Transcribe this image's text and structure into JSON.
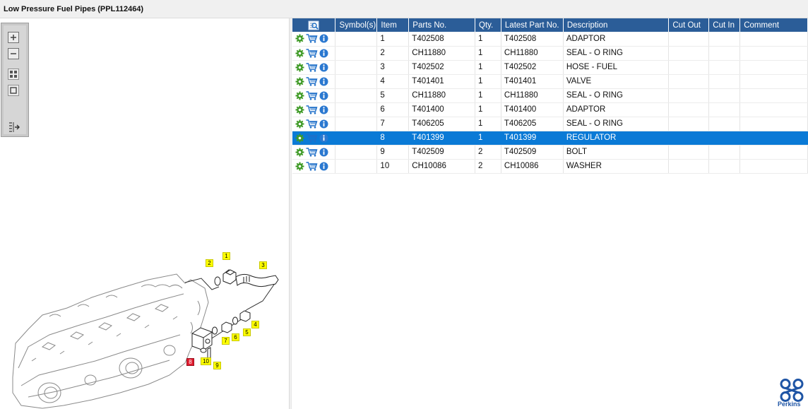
{
  "window": {
    "title": "Low Pressure Fuel Pipes (PPL112464)"
  },
  "toolbar": {
    "buttons": [
      "zoom-in-icon",
      "zoom-out-icon",
      "fit-all-icon",
      "actual-size-icon",
      "toggle-panel-icon"
    ]
  },
  "diagram": {
    "callouts": [
      "1",
      "2",
      "3",
      "4",
      "5",
      "6",
      "7",
      "8",
      "9",
      "10"
    ],
    "highlighted": "8",
    "highlight_color": "#e01c2f",
    "callout_color": "#ffff00"
  },
  "table": {
    "columns": [
      "",
      "Symbol(s)",
      "Item",
      "Parts No.",
      "Qty.",
      "Latest Part No.",
      "Description",
      "Cut Out",
      "Cut In",
      "Comment"
    ],
    "header_color": "#2b5d98",
    "selected_color": "#0a7ad6",
    "row_icons": [
      "gear-icon",
      "cart-icon",
      "info-icon"
    ],
    "rows": [
      {
        "item": "1",
        "part_no": "T402508",
        "qty": "1",
        "latest": "T402508",
        "description": "ADAPTOR"
      },
      {
        "item": "2",
        "part_no": "CH11880",
        "qty": "1",
        "latest": "CH11880",
        "description": "SEAL - O RING"
      },
      {
        "item": "3",
        "part_no": "T402502",
        "qty": "1",
        "latest": "T402502",
        "description": "HOSE - FUEL"
      },
      {
        "item": "4",
        "part_no": "T401401",
        "qty": "1",
        "latest": "T401401",
        "description": "VALVE"
      },
      {
        "item": "5",
        "part_no": "CH11880",
        "qty": "1",
        "latest": "CH11880",
        "description": "SEAL - O RING"
      },
      {
        "item": "6",
        "part_no": "T401400",
        "qty": "1",
        "latest": "T401400",
        "description": "ADAPTOR"
      },
      {
        "item": "7",
        "part_no": "T406205",
        "qty": "1",
        "latest": "T406205",
        "description": "SEAL - O RING"
      },
      {
        "item": "8",
        "part_no": "T401399",
        "qty": "1",
        "latest": "T401399",
        "description": "REGULATOR",
        "selected": true
      },
      {
        "item": "9",
        "part_no": "T402509",
        "qty": "2",
        "latest": "T402509",
        "description": "BOLT"
      },
      {
        "item": "10",
        "part_no": "CH10086",
        "qty": "2",
        "latest": "CH10086",
        "description": "WASHER"
      }
    ]
  },
  "brand": {
    "name": "Perkins",
    "color": "#1f55a5"
  }
}
